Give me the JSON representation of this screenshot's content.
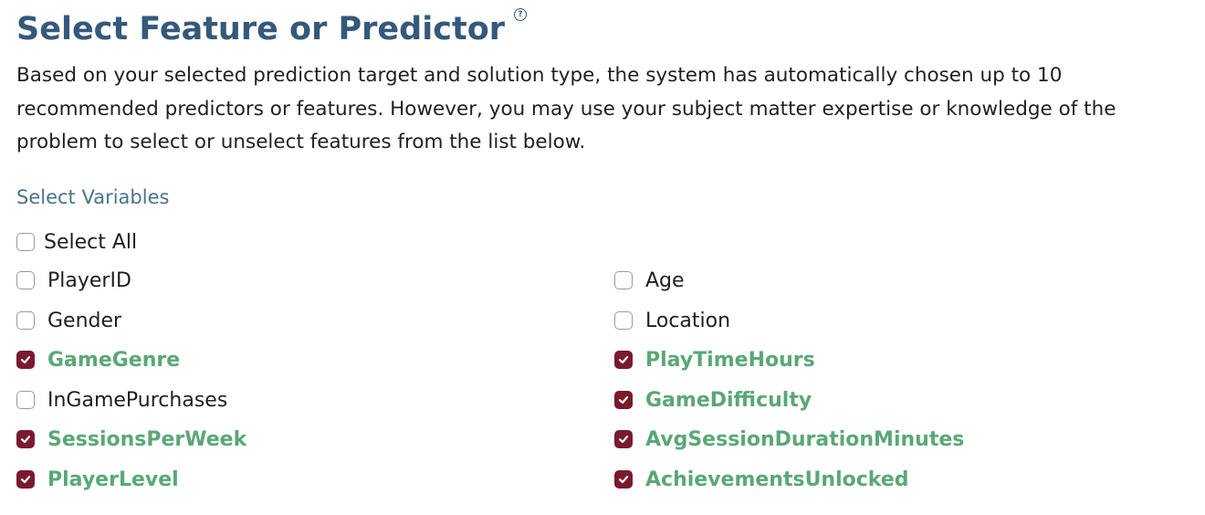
{
  "header": {
    "title": "Select Feature or Predictor",
    "help_glyph": "?"
  },
  "description": "Based on your selected prediction target and solution type, the system has automatically chosen up to 10 recommended predictors or features. However, you may use your subject matter expertise or knowledge of the problem to select or unselect features from the list below.",
  "variables": {
    "section_label": "Select Variables",
    "select_all": {
      "label": "Select All",
      "checked": false
    },
    "items": [
      {
        "label": "PlayerID",
        "checked": false
      },
      {
        "label": "Age",
        "checked": false
      },
      {
        "label": "Gender",
        "checked": false
      },
      {
        "label": "Location",
        "checked": false
      },
      {
        "label": "GameGenre",
        "checked": true
      },
      {
        "label": "PlayTimeHours",
        "checked": true
      },
      {
        "label": "InGamePurchases",
        "checked": false
      },
      {
        "label": "GameDifficulty",
        "checked": true
      },
      {
        "label": "SessionsPerWeek",
        "checked": true
      },
      {
        "label": "AvgSessionDurationMinutes",
        "checked": true
      },
      {
        "label": "PlayerLevel",
        "checked": true
      },
      {
        "label": "AchievementsUnlocked",
        "checked": true
      }
    ]
  },
  "colors": {
    "title": "#34597a",
    "section_label": "#4b7388",
    "checked_box": "#7a1a2f",
    "checked_label": "#5aa876",
    "unchecked_label": "#1f1f1f"
  }
}
